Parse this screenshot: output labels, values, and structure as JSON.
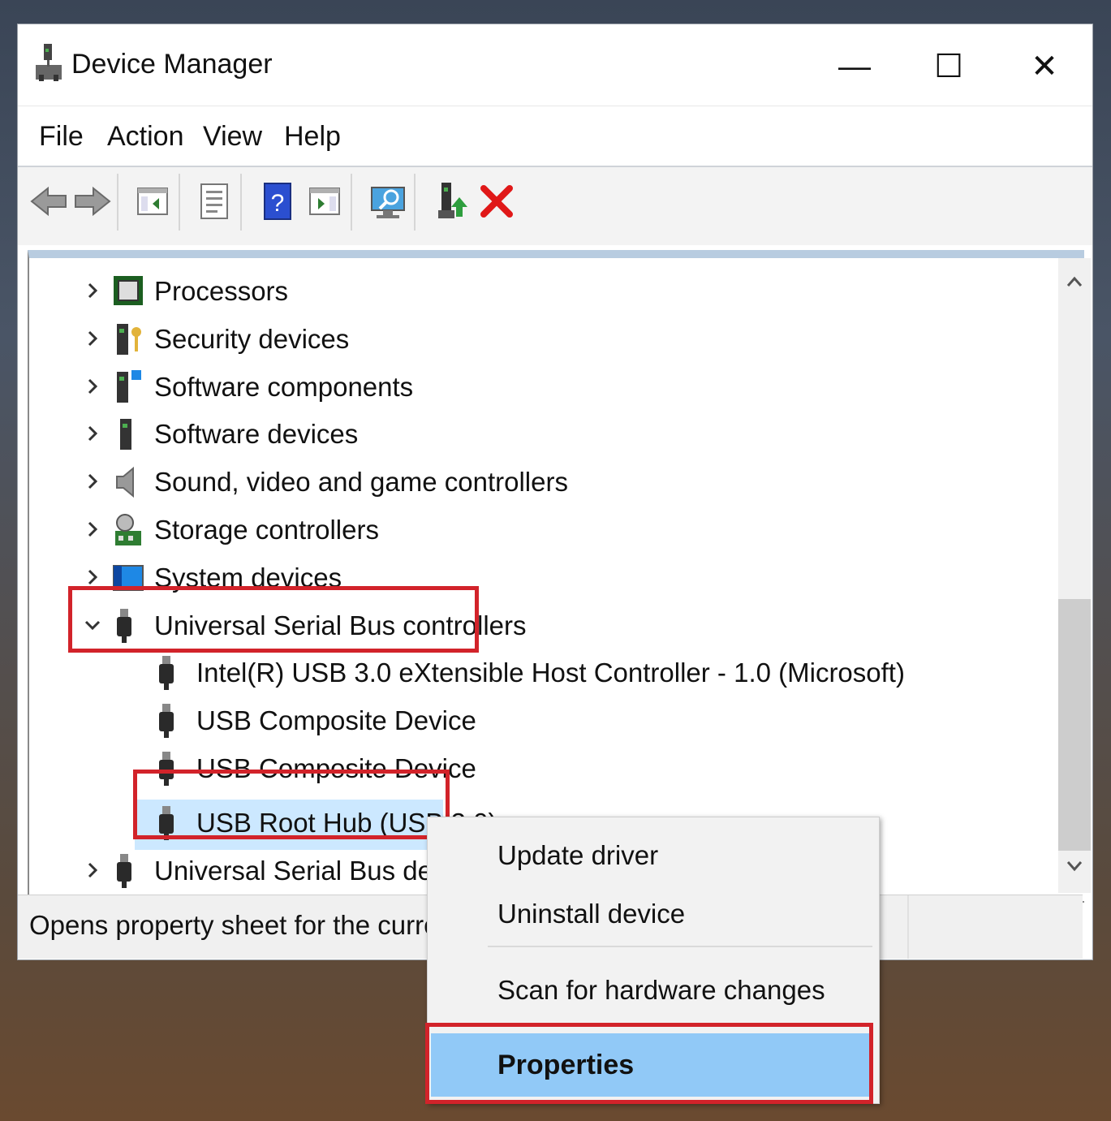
{
  "window": {
    "title": "Device Manager"
  },
  "window_controls": {
    "minimize": "—",
    "maximize": "☐",
    "close": "✕"
  },
  "menu": [
    "File",
    "Action",
    "View",
    "Help"
  ],
  "tree": {
    "categories": [
      {
        "label": "Processors",
        "icon": "processor-icon"
      },
      {
        "label": "Security devices",
        "icon": "security-devices-icon"
      },
      {
        "label": "Software components",
        "icon": "software-components-icon"
      },
      {
        "label": "Software devices",
        "icon": "software-devices-icon"
      },
      {
        "label": "Sound, video and game controllers",
        "icon": "speaker-icon"
      },
      {
        "label": "Storage controllers",
        "icon": "storage-controller-icon"
      },
      {
        "label": "System devices",
        "icon": "system-devices-icon"
      },
      {
        "label": "Universal Serial Bus controllers",
        "icon": "usb-icon",
        "expanded": true
      }
    ],
    "usb_children": [
      "Intel(R) USB 3.0 eXtensible Host Controller - 1.0 (Microsoft)",
      "USB Composite Device",
      "USB Composite Device",
      "USB Root Hub (USB 3.0)"
    ],
    "last_category": "Universal Serial Bus device"
  },
  "status": {
    "text": "Opens property sheet for the current se"
  },
  "context_menu": {
    "items": [
      "Update driver",
      "Uninstall device",
      "Scan for hardware changes",
      "Properties"
    ]
  },
  "colors": {
    "highlight_box": "#d2232a",
    "menu_selection": "#91c9f7"
  }
}
